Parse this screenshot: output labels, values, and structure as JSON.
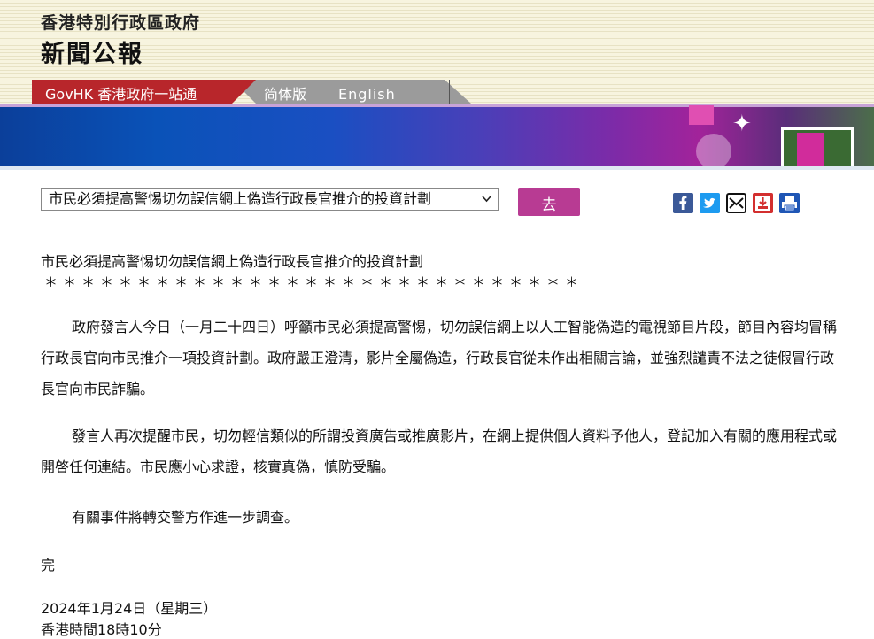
{
  "header": {
    "gov_name": "香港特別行政區政府",
    "title": "新聞公報"
  },
  "nav": {
    "govhk": "GovHK 香港政府一站通",
    "simplified": "简体版",
    "english": "English"
  },
  "toolbar": {
    "select_value": "市民必須提高警惕切勿誤信網上偽造行政長官推介的投資計劃",
    "go_label": "去"
  },
  "share_icons": [
    "facebook-icon",
    "twitter-icon",
    "email-icon",
    "bookmark-icon",
    "print-icon"
  ],
  "article": {
    "title": "市民必須提高警惕切勿誤信網上偽造行政長官推介的投資計劃",
    "stars": "＊＊＊＊＊＊＊＊＊＊＊＊＊＊＊＊＊＊＊＊＊＊＊＊＊＊＊＊＊",
    "paragraphs": [
      "政府發言人今日（一月二十四日）呼籲市民必須提高警惕，切勿誤信網上以人工智能偽造的電視節目片段，節目內容均冒稱行政長官向市民推介一項投資計劃。政府嚴正澄清，影片全屬偽造，行政長官從未作出相關言論，並強烈譴責不法之徒假冒行政長官向市民詐騙。",
      "發言人再次提醒市民，切勿輕信類似的所謂投資廣告或推廣影片，在網上提供個人資料予他人，登記加入有關的應用程式或開啓任何連結。市民應小心求證，核實真偽，慎防受騙。",
      "有關事件將轉交警方作進一步調查。"
    ],
    "end_mark": "完",
    "date": "2024年1月24日（星期三）",
    "time": "香港時間18時10分"
  },
  "colors": {
    "govhk_red": "#b8262b",
    "go_button": "#b83b93",
    "header_bg": "#f7f4df"
  }
}
